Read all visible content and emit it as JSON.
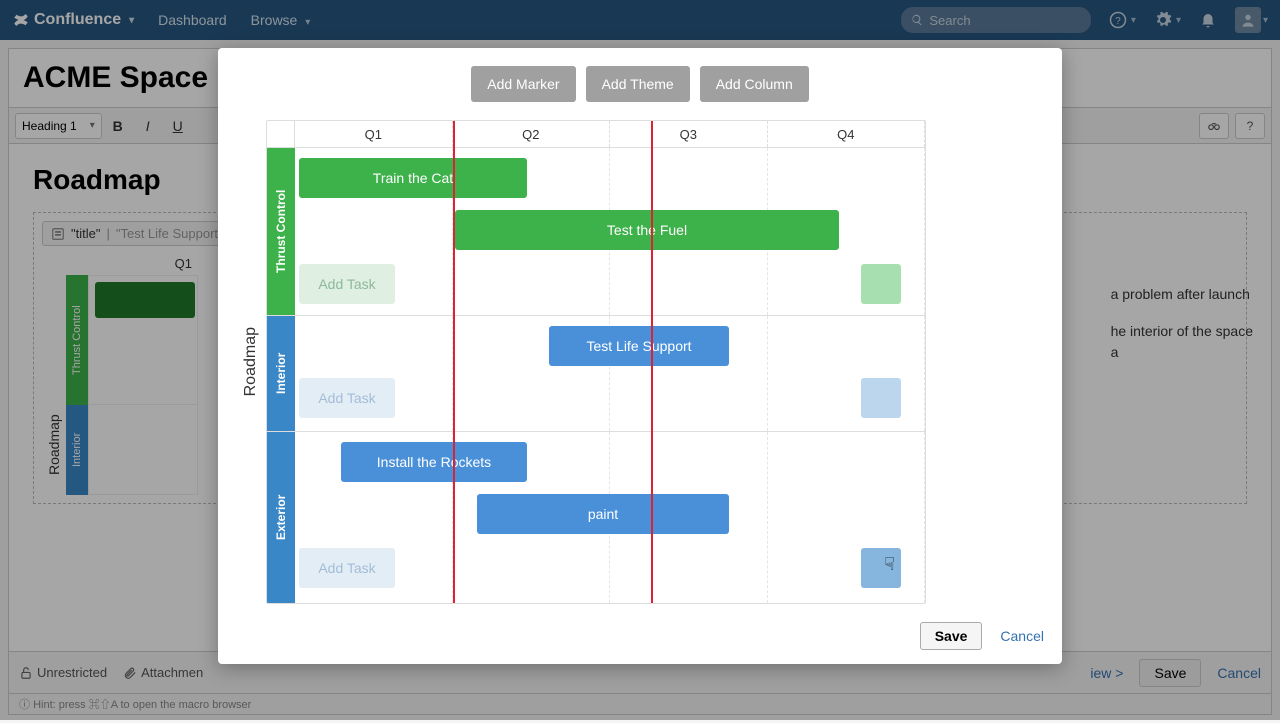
{
  "nav": {
    "brand": "Confluence",
    "dashboard": "Dashboard",
    "browse": "Browse",
    "search_placeholder": "Search"
  },
  "page": {
    "title_truncated": "ACME Space Rac",
    "heading_style": "Heading 1",
    "section_heading": "Roadmap",
    "macro_prefix": "\"title\"",
    "macro_value": "\"Test Life Support\"",
    "mini_q": "Q1",
    "mini_lane1": "Thrust Control",
    "mini_lane2": "Interior",
    "body_line1": "a problem after launch",
    "body_line2": "he interior of the space",
    "body_line3": "a",
    "footer_unrestricted": "Unrestricted",
    "footer_attachments": "Attachmen",
    "footer_view": "iew >",
    "footer_save": "Save",
    "footer_cancel": "Cancel",
    "hint": "Hint: press ⌘⇧A to open the macro browser",
    "tb_question": "?"
  },
  "modal": {
    "btn_marker": "Add Marker",
    "btn_theme": "Add Theme",
    "btn_column": "Add Column",
    "title": "Roadmap",
    "columns": [
      "Q1",
      "Q2",
      "Q3",
      "Q4"
    ],
    "add_task": "Add Task",
    "lanes": {
      "thrust": {
        "label": "Thrust Control",
        "bars": {
          "train_cat": "Train the Cat",
          "test_fuel": "Test the Fuel"
        }
      },
      "interior": {
        "label": "Interior",
        "bars": {
          "life_support": "Test Life Support"
        }
      },
      "exterior": {
        "label": "Exterior",
        "bars": {
          "rockets": "Install the Rockets",
          "paint": "paint"
        }
      }
    },
    "save": "Save",
    "cancel": "Cancel"
  },
  "chart_data": {
    "type": "table",
    "title": "Roadmap",
    "columns": [
      "Q1",
      "Q2",
      "Q3",
      "Q4"
    ],
    "lanes": [
      {
        "name": "Thrust Control",
        "color": "#3db14a",
        "tasks": [
          {
            "label": "Train the Cat",
            "start": 0.0,
            "end": 1.45
          },
          {
            "label": "Test the Fuel",
            "start": 1.0,
            "end": 3.45
          }
        ]
      },
      {
        "name": "Interior",
        "color": "#4a90d9",
        "tasks": [
          {
            "label": "Test Life Support",
            "start": 1.6,
            "end": 2.75
          }
        ]
      },
      {
        "name": "Exterior",
        "color": "#4a90d9",
        "tasks": [
          {
            "label": "Install the Rockets",
            "start": 0.3,
            "end": 1.45
          },
          {
            "label": "paint",
            "start": 1.15,
            "end": 2.75
          }
        ]
      }
    ],
    "markers_at_columns": [
      1,
      2.25
    ]
  }
}
